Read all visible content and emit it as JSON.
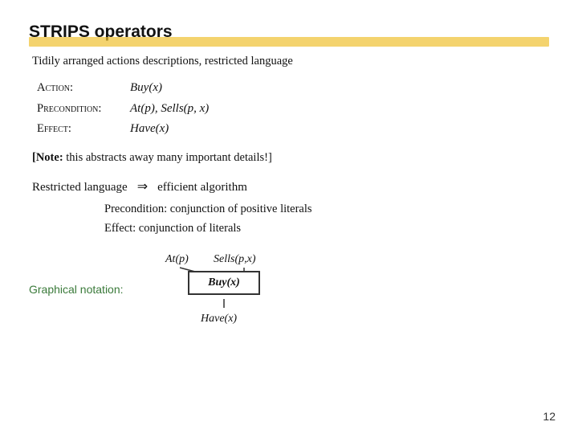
{
  "title": "STRIPS operators",
  "intro_text": "Tidily arranged actions descriptions, restricted language",
  "action_label": "Action:",
  "action_value": "Buy(x)",
  "precondition_label": "Precondition:",
  "precondition_value": "At(p), Sells(p, x)",
  "effect_label": "Effect:",
  "effect_value": "Have(x)",
  "note_prefix": "[Note:",
  "note_text": "this abstracts away many important details!]",
  "restricted_label": "Restricted language",
  "arrow": "⇒",
  "restricted_result": "efficient algorithm",
  "sub_item_1": "Precondition: conjunction of positive literals",
  "sub_item_2": "Effect: conjunction of literals",
  "graphical_label": "Graphical notation:",
  "diagram": {
    "at_p": "At(p)",
    "sells": "Sells(p,x)",
    "box": "Buy(x)",
    "have": "Have(x)"
  },
  "page_number": "12"
}
